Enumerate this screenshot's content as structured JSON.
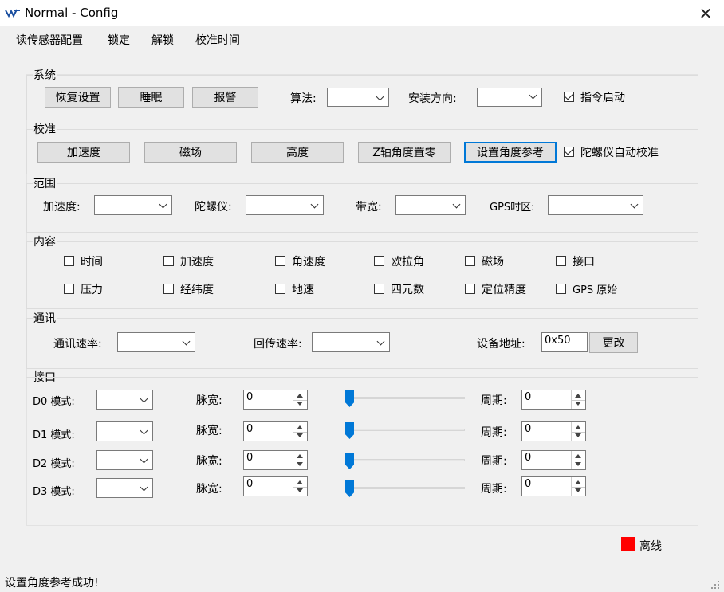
{
  "window": {
    "title": "Normal - Config",
    "close": "✕"
  },
  "menu": [
    "读传感器配置",
    "锁定",
    "解锁",
    "校准时间"
  ],
  "system": {
    "label": "系统",
    "buttons": [
      "恢复设置",
      "睡眠",
      "报警"
    ],
    "algorithm_label": "算法:",
    "algorithm_value": "",
    "install_label": "安装方向:",
    "install_value": "",
    "command_start_label": "指令启动",
    "command_start_checked": true
  },
  "calibration": {
    "label": "校准",
    "buttons": [
      "加速度",
      "磁场",
      "高度",
      "Z轴角度置零",
      "设置角度参考"
    ],
    "gyro_auto_label": "陀螺仪自动校准",
    "gyro_auto_checked": true
  },
  "range": {
    "label": "范围",
    "acc_label": "加速度:",
    "gyro_label": "陀螺仪:",
    "bandwidth_label": "带宽:",
    "gps_tz_label": "GPS时区:"
  },
  "content": {
    "label": "内容",
    "row1": [
      "时间",
      "加速度",
      "角速度",
      "欧拉角",
      "磁场",
      "接口"
    ],
    "row2": [
      "压力",
      "经纬度",
      "地速",
      "四元数",
      "定位精度",
      "GPS 原始"
    ]
  },
  "comm": {
    "label": "通讯",
    "baud_label": "通讯速率:",
    "return_label": "回传速率:",
    "addr_label": "设备地址:",
    "addr_value": "0x50",
    "change_button": "更改"
  },
  "ports": {
    "label": "接口",
    "rows": [
      {
        "name": "D0 模式:",
        "pulse_label": "脉宽:",
        "pulse_value": "0",
        "period_label": "周期:",
        "period_value": "0",
        "slider_level": 0
      },
      {
        "name": "D1 模式:",
        "pulse_label": "脉宽:",
        "pulse_value": "0",
        "period_label": "周期:",
        "period_value": "0",
        "slider_level": 0
      },
      {
        "name": "D2 模式:",
        "pulse_label": "脉宽:",
        "pulse_value": "0",
        "period_label": "周期:",
        "period_value": "0",
        "slider_level": 0
      },
      {
        "name": "D3 模式:",
        "pulse_label": "脉宽:",
        "pulse_value": "0",
        "period_label": "周期:",
        "period_value": "0",
        "slider_level": 0
      }
    ]
  },
  "connection": {
    "status": "离线",
    "color": "#ff0000"
  },
  "status_bar": {
    "message": "设置角度参考成功!"
  }
}
